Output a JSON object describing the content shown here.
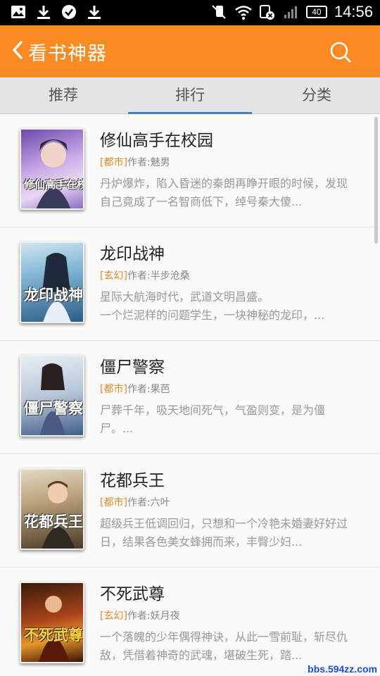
{
  "status_bar": {
    "time": "14:56",
    "battery": "40",
    "left_icons": [
      "image-icon",
      "download-icon",
      "check-circle-icon",
      "download-icon"
    ],
    "right_icons": [
      "mute-icon",
      "wifi-icon",
      "sim-x-icon",
      "signal-icon"
    ]
  },
  "header": {
    "title": "看书神器",
    "back_icon": "chevron-left-icon",
    "search_icon": "search-icon",
    "bg_color": "#f98b22"
  },
  "tabs": [
    {
      "label": "推荐",
      "active": false
    },
    {
      "label": "排行",
      "active": true
    },
    {
      "label": "分类",
      "active": false
    }
  ],
  "books": [
    {
      "title": "修仙高手在校园",
      "genre": "[都市]",
      "author": "作者:魅男",
      "description": "丹炉爆炸，陷入昏迷的秦朗再睁开眼的时候，发现自己竟成了一名智商低下，绰号秦大傻...",
      "cover_text": "修仙高手在校园"
    },
    {
      "title": "龙印战神",
      "genre": "[玄幻]",
      "author": "作者:半步沧桑",
      "description": "星际大航海时代，武道文明昌盛。\n一个烂泥样的问题学生，一块神秘的龙印，...",
      "cover_text": "龙印战神"
    },
    {
      "title": "僵尸警察",
      "genre": "[都市]",
      "author": "作者:果芭",
      "description": "尸葬千年，吸天地间死气，气盈则变，是为僵尸。...",
      "cover_text": "僵尸警察"
    },
    {
      "title": "花都兵王",
      "genre": "[都市]",
      "author": "作者:六叶",
      "description": "超级兵王低调回归，只想和一个冷艳未婚妻好好过日，结果各色美女蜂拥而来，丰臀少妇...",
      "cover_text": "花都兵王"
    },
    {
      "title": "不死武尊",
      "genre": "[玄幻]",
      "author": "作者:妖月夜",
      "description": "一个落魄的少年偶得神诀，从此一雪前耻，斩尽仇敌，凭借着神奇的武魂，堪破生死，踏...",
      "cover_text": "不死武尊"
    }
  ],
  "watermark": "bbs.594zz.com"
}
